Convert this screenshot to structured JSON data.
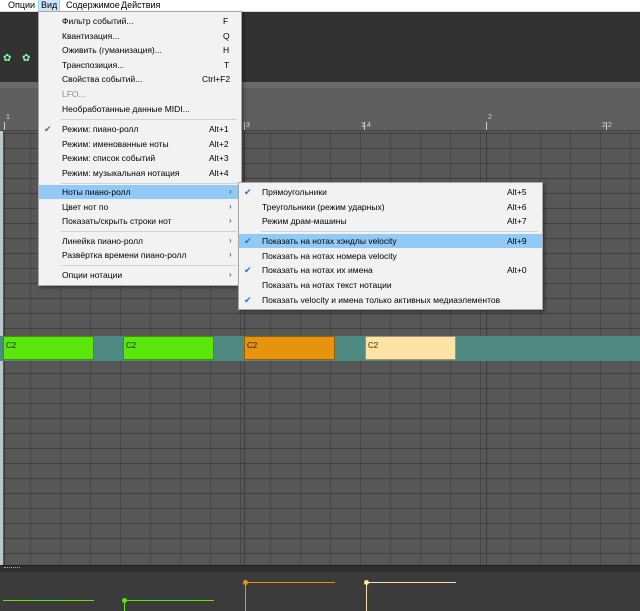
{
  "menubar": {
    "items": [
      "Опции",
      "Вид",
      "Содержимое",
      "Действия"
    ]
  },
  "view_menu": {
    "items": [
      {
        "label": "Фильтр событий...",
        "shortcut": "F"
      },
      {
        "label": "Квантизация...",
        "shortcut": "Q"
      },
      {
        "label": "Оживить (гуманизация)...",
        "shortcut": "H"
      },
      {
        "label": "Транспозиция...",
        "shortcut": "T"
      },
      {
        "label": "Свойства событий...",
        "shortcut": "Ctrl+F2"
      },
      {
        "label": "LFO...",
        "shortcut": ""
      },
      {
        "label": "Необработанные данные MIDI...",
        "shortcut": ""
      },
      {
        "label": "Режим: пиано-ролл",
        "shortcut": "Alt+1"
      },
      {
        "label": "Режим: именованные ноты",
        "shortcut": "Alt+2"
      },
      {
        "label": "Режим: список событий",
        "shortcut": "Alt+3"
      },
      {
        "label": "Режим: музыкальная нотация",
        "shortcut": "Alt+4"
      },
      {
        "label": "Ноты пиано-ролл",
        "shortcut": ""
      },
      {
        "label": "Цвет нот по",
        "shortcut": ""
      },
      {
        "label": "Показать/скрыть строки нот",
        "shortcut": ""
      },
      {
        "label": "Линейка пиано-ролл",
        "shortcut": ""
      },
      {
        "label": "Развёртка времени пиано-ролл",
        "shortcut": ""
      },
      {
        "label": "Опции нотации",
        "shortcut": ""
      }
    ]
  },
  "notes_submenu": {
    "items": [
      {
        "label": "Прямоугольники",
        "shortcut": "Alt+5"
      },
      {
        "label": "Треугольники (режим ударных)",
        "shortcut": "Alt+6"
      },
      {
        "label": "Режим драм-машины",
        "shortcut": "Alt+7"
      },
      {
        "label": "Показать на нотах хэндлы velocity",
        "shortcut": "Alt+9"
      },
      {
        "label": "Показать на нотах номера velocity",
        "shortcut": ""
      },
      {
        "label": "Показать на нотах их имена",
        "shortcut": "Alt+0"
      },
      {
        "label": "Показать на нотах текст нотации",
        "shortcut": ""
      },
      {
        "label": "Показать velocity и имена только активных медиаэлементов",
        "shortcut": ""
      }
    ]
  },
  "ruler": {
    "labels": [
      "1",
      "3",
      "1.4",
      "2",
      "2.2"
    ]
  },
  "notes": [
    {
      "name": "C2",
      "color": "#5de60c"
    },
    {
      "name": "C2",
      "color": "#5de60c"
    },
    {
      "name": "C2",
      "color": "#e8930d"
    },
    {
      "name": "C2",
      "color": "#fde3a4"
    }
  ],
  "icons": {
    "checkmark": "check-icon",
    "submenu": "chevron-right-icon"
  }
}
